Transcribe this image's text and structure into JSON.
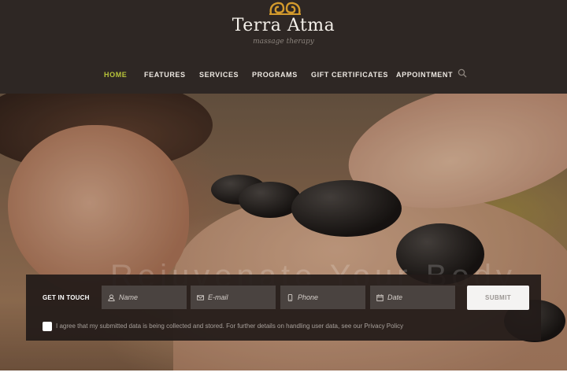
{
  "brand": {
    "name": "Terra Atma",
    "tagline": "massage therapy",
    "logo_icon": "spiral-ornament-icon",
    "accent_color": "#d39a2c"
  },
  "nav": {
    "items": [
      {
        "label": "HOME",
        "active": true
      },
      {
        "label": "FEATURES",
        "active": false
      },
      {
        "label": "SERVICES",
        "active": false
      },
      {
        "label": "PROGRAMS",
        "active": false
      },
      {
        "label": "GIFT CERTIFICATES",
        "active": false
      },
      {
        "label": "APPOINTMENT",
        "active": false
      }
    ],
    "active_color": "#b8c43a",
    "search_icon": "search-icon"
  },
  "hero": {
    "heading": "Rejuvenate Your Body"
  },
  "contact_form": {
    "title": "GET IN TOUCH",
    "fields": [
      {
        "placeholder": "Name",
        "icon": "user-icon"
      },
      {
        "placeholder": "E-mail",
        "icon": "envelope-icon"
      },
      {
        "placeholder": "Phone",
        "icon": "phone-icon"
      },
      {
        "placeholder": "Date",
        "icon": "calendar-icon"
      }
    ],
    "submit_label": "SUBMIT",
    "consent_text": "I agree that my submitted data is being collected and stored. For further details on handling user data, see our Privacy Policy",
    "consent_checked": false
  }
}
